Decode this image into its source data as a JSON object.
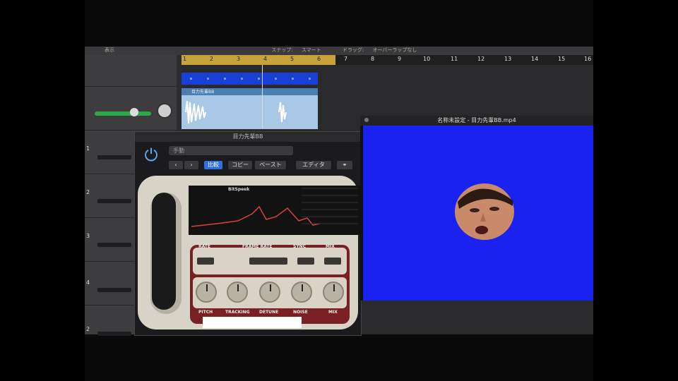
{
  "toolbar": {
    "view_label": "表示",
    "snap_label": "スナップ:",
    "snap_value": "スマート",
    "drag_label": "ドラッグ:",
    "drag_value": "オーバーラップなし"
  },
  "ruler": {
    "bars": [
      "1",
      "2",
      "3",
      "4",
      "5",
      "6",
      "7",
      "8",
      "9",
      "10",
      "11",
      "12",
      "13",
      "14",
      "15",
      "16"
    ]
  },
  "tracks": {
    "numbers": [
      "1",
      "2",
      "3",
      "4",
      "2"
    ],
    "audio_region_name": "目力先輩BB"
  },
  "plugin": {
    "title": "目力先輩BB",
    "preset_value": "手動",
    "compare_label": "比較",
    "copy_label": "コピー",
    "paste_label": "ペースト",
    "editor_label": "エディタ",
    "brand_label": "BitSpeek",
    "top_headers": [
      "RATE",
      "FRAME RATE",
      "SYNC",
      "MIX"
    ],
    "bottom_labels": [
      "PITCH",
      "TRACKING",
      "DETUNE",
      "NOISE",
      "MIX"
    ]
  },
  "video": {
    "title": "名称未設定 - 目力先輩BB.mp4"
  },
  "colors": {
    "accent_blue": "#2f6fe0",
    "video_background": "#1a22f0",
    "cycle_region": "#c8a33a",
    "plugin_panel": "#7a1f24"
  }
}
